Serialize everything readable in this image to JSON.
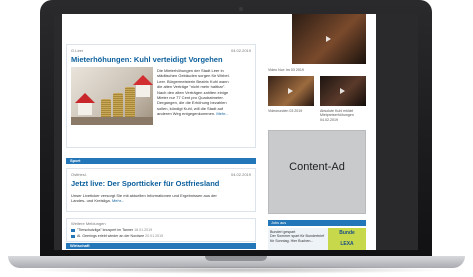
{
  "article1": {
    "source": "G.Leer",
    "date": "04.02.2019",
    "headline": "Mieterhöhungen: Kuhl verteidigt Vorgehen",
    "teaser_lines": [
      "Die Mieterhöhungen der Stadt Leer in",
      "städtischen Gebäuden sorgen für Wirbel.",
      "Leer. Bürgermeisterin Beatrix Kuhl wann",
      "die alten Verträge \"nicht mehr haltbar\".",
      "Nach den alten Verträgen zahlten einige",
      "Mieter nur 77 Cent pro Quadratmeter.",
      "Dergangen, die die Erhöhung bezahlen",
      "sollen, kündigt Kuhl, will die Stadt auf",
      "anderen Weg entgegenkommen."
    ],
    "more": "Mehr..."
  },
  "sport_band": "Sport",
  "article2": {
    "source": "Ostfriesl.",
    "date": "04.02.2019",
    "headline": "Jetzt live: Der Sportticker für Ostfriesland",
    "teaser_lines": [
      "Unser Liveticker versorgt Sie mit aktuellen Informationen und Ergebnissen aus der",
      "Landes- und Kreisliga."
    ],
    "more": "Mehr..."
  },
  "further": {
    "heading": "Weitere Meldungen",
    "items": [
      {
        "text": "\"Tierschutzliga\" knuspert im Tanner",
        "date": "18.01.2019"
      },
      {
        "text": "Al. Geerings erlebt wieder an der Nordsee",
        "date": "20.01.2019"
      }
    ]
  },
  "wirtschaft_band": "Wirtschaft",
  "videos": {
    "top_caption": "Video Nur: Im 03 2019",
    "items": [
      {
        "caption_lines": [
          "Videorunden 03 2019",
          ""
        ]
      },
      {
        "caption_lines": [
          "Absolute Kuhl erklärt",
          "Mietpreiserhöhungen",
          "04.02.2019"
        ]
      }
    ]
  },
  "ad": {
    "label": "Content-Ad"
  },
  "jobs_band": "Jobs aus",
  "promo": {
    "lines": [
      "Bunderl gespart",
      "Der Sommer spart für Bunderbrief",
      "für Sonntag. Hier Buchen..."
    ],
    "badge_line1": "Bunde",
    "badge_line2": "LEXA"
  },
  "colors": {
    "accent": "#2376b7",
    "headline": "#0c5f9c"
  }
}
